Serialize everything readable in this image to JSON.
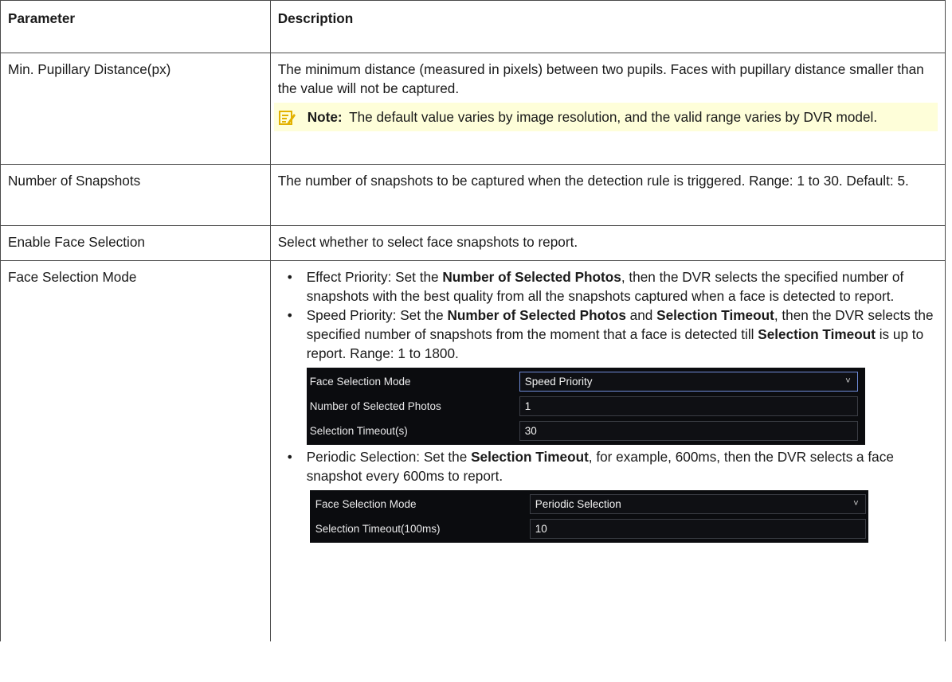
{
  "table": {
    "headers": [
      "Parameter",
      "Description"
    ],
    "row1": {
      "param": "Min. Pupillary Distance(px)",
      "desc": "The minimum distance (measured in pixels) between two pupils. Faces with pupillary distance smaller than the value will not be captured.",
      "note_label": "Note:",
      "note_text": "The default value varies by image resolution, and the valid range varies by DVR model.",
      "note_icon": "note-pencil-icon"
    },
    "row2": {
      "param": "Number of Snapshots",
      "desc": "The number of snapshots to be captured when the detection rule is triggered. Range: 1 to 30. Default: 5."
    },
    "row3": {
      "param": "Enable Face Selection",
      "desc": "Select whether to select face snapshots to report."
    },
    "row4": {
      "param": "Face Selection Mode",
      "bullet": "•",
      "effect": {
        "a": "Effect Priority: Set the ",
        "b1": "Number of Selected Photos",
        "c": ", then the DVR selects the specified number of snapshots with the best quality from all the snapshots captured when a face is detected to report."
      },
      "speed": {
        "a": "Speed Priority: Set the ",
        "b1": "Number of Selected Photos",
        "c": " and ",
        "b2": "Selection Timeout",
        "d": ", then the DVR selects the specified number of snapshots from the moment that a face is detected till ",
        "b3": "Selection Timeout",
        "e": " is up to report. Range: 1 to 1800."
      },
      "periodic": {
        "a": "Periodic Selection: Set the ",
        "b1": "Selection Timeout",
        "c": ", for example, 600ms, then the DVR selects a face snapshot every 600ms to report."
      },
      "ui1": {
        "mode_label": "Face Selection Mode",
        "mode_value": "Speed Priority",
        "photos_label": "Number of Selected Photos",
        "photos_value": "1",
        "timeout_label": "Selection Timeout(s)",
        "timeout_value": "30",
        "caret": "˅"
      },
      "ui2": {
        "mode_label": "Face Selection Mode",
        "mode_value": "Periodic Selection",
        "timeout_label": "Selection Timeout(100ms)",
        "timeout_value": "10",
        "caret": "˅"
      }
    }
  },
  "colors": {
    "note_bg": "#fefed9",
    "note_icon": "#e2b100",
    "panel_bg": "#0b0c0f",
    "select_border": "#6f8bd8"
  }
}
